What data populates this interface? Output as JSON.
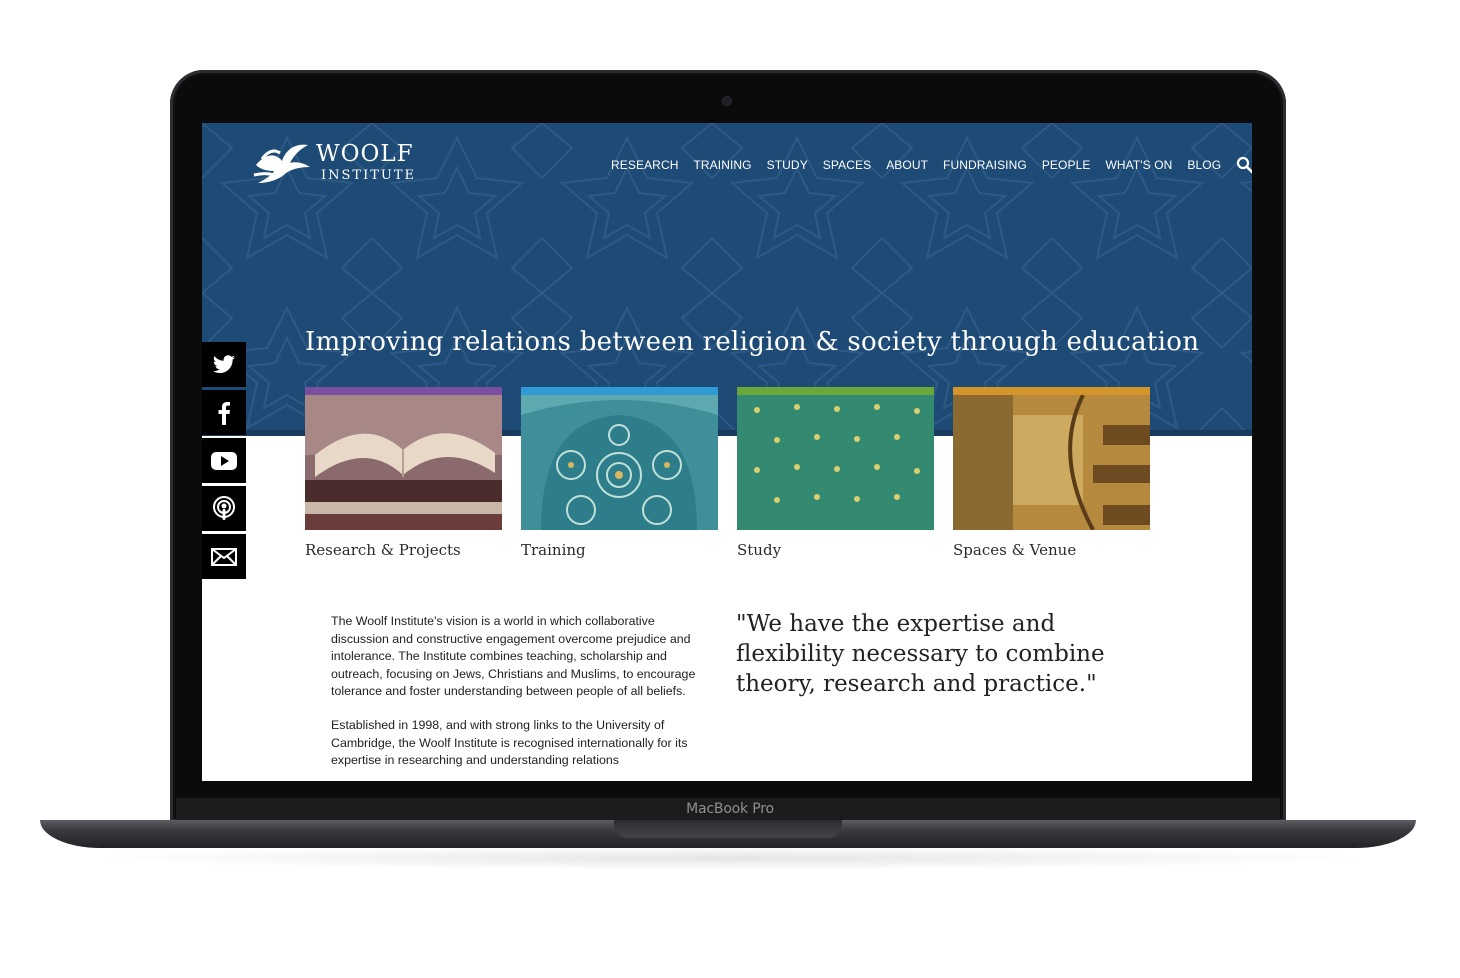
{
  "device": {
    "model_label": "MacBook Pro"
  },
  "site": {
    "logo": {
      "line1": "WOOLF",
      "line2": "INSTITUTE"
    },
    "nav": [
      "RESEARCH",
      "TRAINING",
      "STUDY",
      "SPACES",
      "ABOUT",
      "FUNDRAISING",
      "PEOPLE",
      "WHAT'S ON",
      "BLOG"
    ],
    "search_icon": "search-icon",
    "tagline": "Improving relations between religion & society through education",
    "tiles": [
      {
        "label": "Research & Projects",
        "accent": "#7b4fa0"
      },
      {
        "label": "Training",
        "accent": "#2f9ad6"
      },
      {
        "label": "Study",
        "accent": "#6aa83a"
      },
      {
        "label": "Spaces & Venue",
        "accent": "#d4962a"
      }
    ],
    "social": [
      "twitter-icon",
      "facebook-icon",
      "youtube-icon",
      "podcast-icon",
      "mail-icon"
    ],
    "intro": {
      "p1": "The Woolf Institute's vision is a world in which collaborative discussion and constructive engagement overcome prejudice and intolerance.  The Institute combines teaching, scholarship and outreach, focusing on Jews, Christians and Muslims, to encourage tolerance and foster understanding between people of all beliefs.",
      "p2": "Established in 1998, and with strong links to the University of Cambridge, the Woolf Institute is recognised internationally for its expertise in researching and understanding relations"
    },
    "quote": "\"We have the expertise and flexibility necessary to combine theory, research and practice.\"",
    "colors": {
      "hero": "#1e4a76",
      "sidebar": "#000000"
    }
  }
}
